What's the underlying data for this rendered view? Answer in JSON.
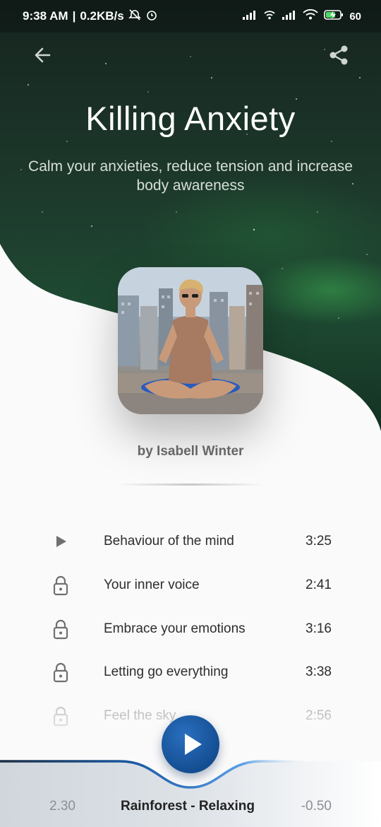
{
  "status_bar": {
    "time": "9:38 AM",
    "speed": "0.2KB/s",
    "battery": "60"
  },
  "header": {
    "title": "Killing Anxiety",
    "subtitle": "Calm your anxieties, reduce tension and increase body awareness"
  },
  "author": "by Isabell Winter",
  "tracks": [
    {
      "icon": "play-icon",
      "name": "Behaviour of the mind",
      "duration": "3:25"
    },
    {
      "icon": "lock-icon",
      "name": "Your inner voice",
      "duration": "2:41"
    },
    {
      "icon": "lock-icon",
      "name": "Embrace your emotions",
      "duration": "3:16"
    },
    {
      "icon": "lock-icon",
      "name": "Letting go everything",
      "duration": "3:38"
    },
    {
      "icon": "lock-icon",
      "name": "Feel the sky",
      "duration": "2:56"
    }
  ],
  "player": {
    "elapsed": "2.30",
    "title": "Rainforest - Relaxing",
    "remaining": "-0.50"
  },
  "colors": {
    "accent": "#1a5aa6",
    "hero_dark": "#16241f",
    "aurora": "#3caa50"
  }
}
